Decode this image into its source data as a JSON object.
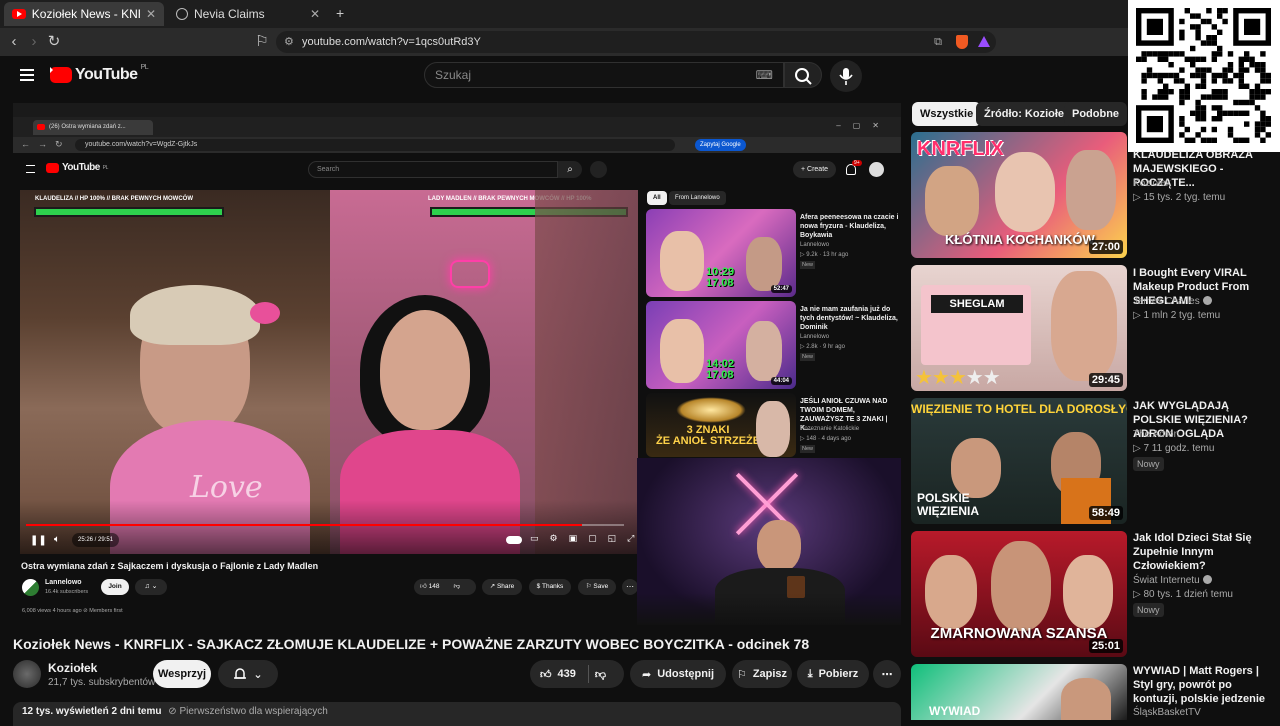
{
  "browser": {
    "tabs": [
      {
        "label": "Koziołek News - KNRFLIX - S...",
        "active": true
      },
      {
        "label": "Nevia Claims",
        "active": false
      }
    ],
    "new_tab": "+",
    "url": "youtube.com/watch?v=1qcs0utRd3Y"
  },
  "header": {
    "logo_text": "YouTube",
    "logo_country": "PL",
    "search_placeholder": "Szukaj",
    "search_kbd": "⌨"
  },
  "embedded": {
    "tabs": [
      {
        "label": "(26) Ostra wymiana zdań z..."
      }
    ],
    "url": "youtube.com/watch?v=WgdZ-GjtkJs",
    "ask_google": "Zapytaj Google",
    "logo_text": "YouTube",
    "logo_country": "PL",
    "search_placeholder": "Search",
    "create_label": "+ Create",
    "notif_count": "9+",
    "player": {
      "left_header": "KLAUDELIZA // HP 100% // BRAK PEWNYCH MOWCÓW",
      "right_header": "LADY MADLEN // BRAK PEWNYCH MOWCÓW // HP 100%",
      "time": "25:26 / 29:51",
      "shirt_text": "Love",
      "progress": 0.93
    },
    "video_title": "Ostra wymiana zdań z Sajkaczem i dyskusja o Fajlonie z Lady Madlen",
    "channel": "Lannelowo",
    "subs": "16.4k subscribers",
    "join": "Join",
    "likes": "148",
    "share": "Share",
    "thanks": "Thanks",
    "save": "Save",
    "views": "6,008 views  4 hours ago  ⊘ Members first",
    "chips": [
      "All",
      "From Lannelowo"
    ],
    "recs": [
      {
        "title": "Afera peeneesowa na czacie i nowa fryzura - Klaudeliza, Boykawia",
        "channel": "Lannelowo",
        "meta": "▷ 9.2k · 13 hr ago",
        "badge": "New",
        "duration": "52:47",
        "overlay": "10:29\n17.08"
      },
      {
        "title": "Ja nie mam zaufania już do tych dentystów! ~ Klaudeliza, Dominik",
        "channel": "Lannelowo",
        "meta": "▷ 2.8k · 9 hr ago",
        "badge": "New",
        "duration": "44:04",
        "overlay": "14:02\n17.08"
      },
      {
        "title": "JEŚLI ANIOŁ CZUWA NAD TWOIM DOMEM, ZAUWAŻYSZ TE 3 ZNAKI | K...",
        "channel": "Rozeznanie Katolickie",
        "meta": "▷ 148 · 4 days ago",
        "badge": "New",
        "overlay": "3 ZNAKI\nŻE ANIOŁ STRZEŻE"
      }
    ]
  },
  "video": {
    "title": "Koziołek News - KNRFLIX - SAJKACZ ZŁOMUJE KLAUDELIZE + POWAŻNE ZARZUTY WOBEC BOYCZITKA - odcinek 78",
    "channel": "Koziołek",
    "subs": "21,7 tys. subskrybentów",
    "join_btn": "Wesprzyj",
    "likes": "439",
    "share": "Udostępnij",
    "save": "Zapisz",
    "download": "Pobierz",
    "meta_views": "12 tys. wyświetleń  2 dni temu",
    "meta_members": "⊘ Pierwszeństwo dla wspierających"
  },
  "sidebar": {
    "chips": [
      "Wszystkie",
      "Źródło: Koziołek",
      "Podobne"
    ],
    "items": [
      {
        "thumb_text": "KNRFLIX",
        "thumb_sub": "KŁÓTNIA KOCHANKÓW",
        "duration": "27:00",
        "title": "KLAUDELIZA OBRAZA MAJEWSKIEGO - POCZĄTE...",
        "channel": "Koziołek",
        "meta": "▷ 15 tys.  2 tyg. temu",
        "badge": ""
      },
      {
        "thumb_text": "SHEGLAM",
        "duration": "29:45",
        "title": "I Bought Every VIRAL Makeup Product From SHEGLAM!",
        "channel": "James Charles",
        "verified": true,
        "meta": "▷ 1 mln  2 tyg. temu",
        "badge": ""
      },
      {
        "thumb_text": "WIĘZIENIE TO HOTEL DLA DOROSŁYCH",
        "thumb_sub": "POLSKIE WIĘZIENIA",
        "duration": "58:49",
        "title": "JAK WYGLĄDAJĄ POLSKIE WIĘZIENIA? ADRON OGLĄDA",
        "channel": "The Adron",
        "meta": "▷ 7  11 godz. temu",
        "badge": "Nowy"
      },
      {
        "thumb_text": "ZMARNOWANA SZANSA",
        "duration": "25:01",
        "title": "Jak Idol Dzieci Stał Się Zupełnie Innym Człowiekiem?",
        "channel": "Świat Internetu",
        "verified": true,
        "meta": "▷ 80 tys.  1 dzień temu",
        "badge": "Nowy"
      },
      {
        "thumb_text": "WYWIAD",
        "title": "WYWIAD | Matt Rogers | Styl gry, powrót po kontuzji, polskie jedzenie",
        "channel": "ŚląskBasketTV",
        "meta": "",
        "badge": ""
      }
    ]
  },
  "colors": {
    "accent": "#ff0000",
    "bg": "#0f0f0f",
    "chip": "#272727",
    "pink": "#e8509a",
    "hp_bar": "#2ed14d"
  },
  "icons": [
    "youtube-icon",
    "globe-icon",
    "back-icon",
    "forward-icon",
    "reload-icon",
    "bookmark-icon",
    "menu-icon",
    "search-icon",
    "mic-icon",
    "like-icon",
    "dislike-icon",
    "share-icon",
    "save-icon",
    "download-icon",
    "more-icon",
    "bell-icon",
    "chevron-down-icon",
    "verified-icon",
    "qr-code"
  ]
}
